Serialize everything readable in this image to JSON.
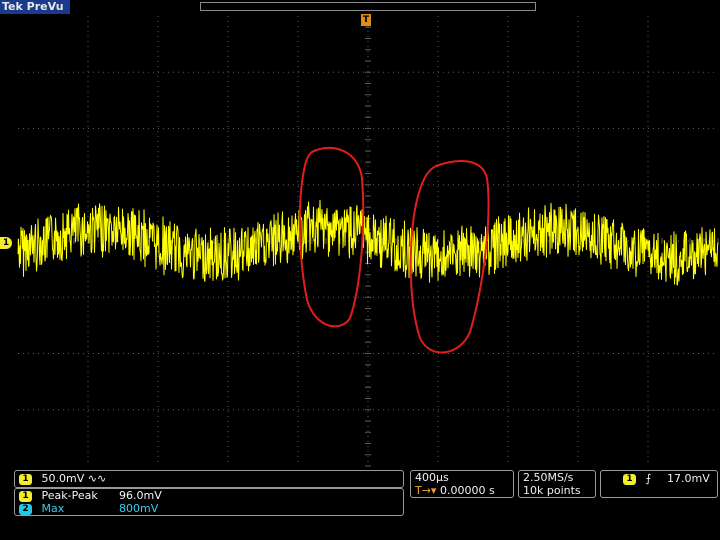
{
  "header": {
    "brand": "Tek PreVu"
  },
  "markers": {
    "trigger_position": "T",
    "channel1": "1"
  },
  "channel_panel": {
    "badge": "1",
    "scale": "50.0mV",
    "coupling_symbol": "∿∿"
  },
  "measurements": [
    {
      "badge": "1",
      "name": "Peak-Peak",
      "value": "96.0mV"
    },
    {
      "badge": "2",
      "name": "Max",
      "value": "800mV"
    }
  ],
  "timebase": {
    "scale": "400µs",
    "delay_icon": "T→▾",
    "delay": "0.00000 s"
  },
  "acquisition": {
    "sample_rate": "2.50MS/s",
    "record_length": "10k points"
  },
  "trigger": {
    "badge": "1",
    "slope_icon": "rising-edge",
    "slope_symbol": "⨍",
    "level": "17.0mV"
  },
  "colors": {
    "trace": "#ffff00",
    "grid": "#5a5a5a",
    "annotation": "#e01e1e",
    "background": "#000000"
  }
}
